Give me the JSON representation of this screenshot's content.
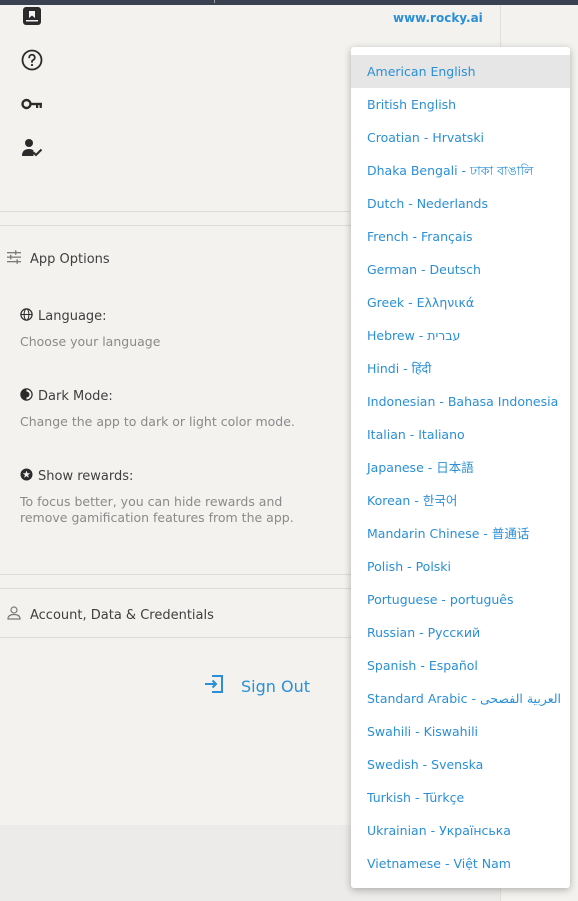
{
  "header": {
    "site_link": "www.rocky.ai"
  },
  "side_icons": [
    {
      "name": "journal-icon"
    },
    {
      "name": "help-icon"
    },
    {
      "name": "key-icon"
    },
    {
      "name": "user-check-icon"
    }
  ],
  "app_options": {
    "title": "App Options",
    "language": {
      "label": "Language:",
      "description": "Choose your language"
    },
    "dark_mode": {
      "label": "Dark Mode:",
      "description": "Change the app to dark or light color mode."
    },
    "rewards": {
      "label": "Show rewards:",
      "description_line1": "To focus better, you can hide rewards and",
      "description_line2": "remove gamification features from the app."
    }
  },
  "account": {
    "title": "Account, Data & Credentials"
  },
  "sign_out": {
    "label": "Sign Out"
  },
  "language_dropdown": {
    "selected": "American English",
    "options": [
      "American English",
      "British English",
      "Croatian - Hrvatski",
      "Dhaka Bengali - ঢাকা বাঙালি",
      "Dutch - Nederlands",
      "French - Français",
      "German - Deutsch",
      "Greek - Ελληνικά",
      "Hebrew - עברית",
      "Hindi - हिंदी",
      "Indonesian - Bahasa Indonesia",
      "Italian - Italiano",
      "Japanese - 日本語",
      "Korean - 한국어",
      "Mandarin Chinese - 普通话",
      "Polish - Polski",
      "Portuguese - português",
      "Russian - Русский",
      "Spanish - Español",
      "Standard Arabic - العربية الفصحى",
      "Swahili - Kiswahili",
      "Swedish - Svenska",
      "Turkish - Türkçe",
      "Ukrainian - Українська",
      "Vietnamese - Việt Nam"
    ]
  },
  "colors": {
    "accent": "#2a8fd6",
    "background": "#f3f2ef",
    "selected_row": "#e6e6e6"
  }
}
